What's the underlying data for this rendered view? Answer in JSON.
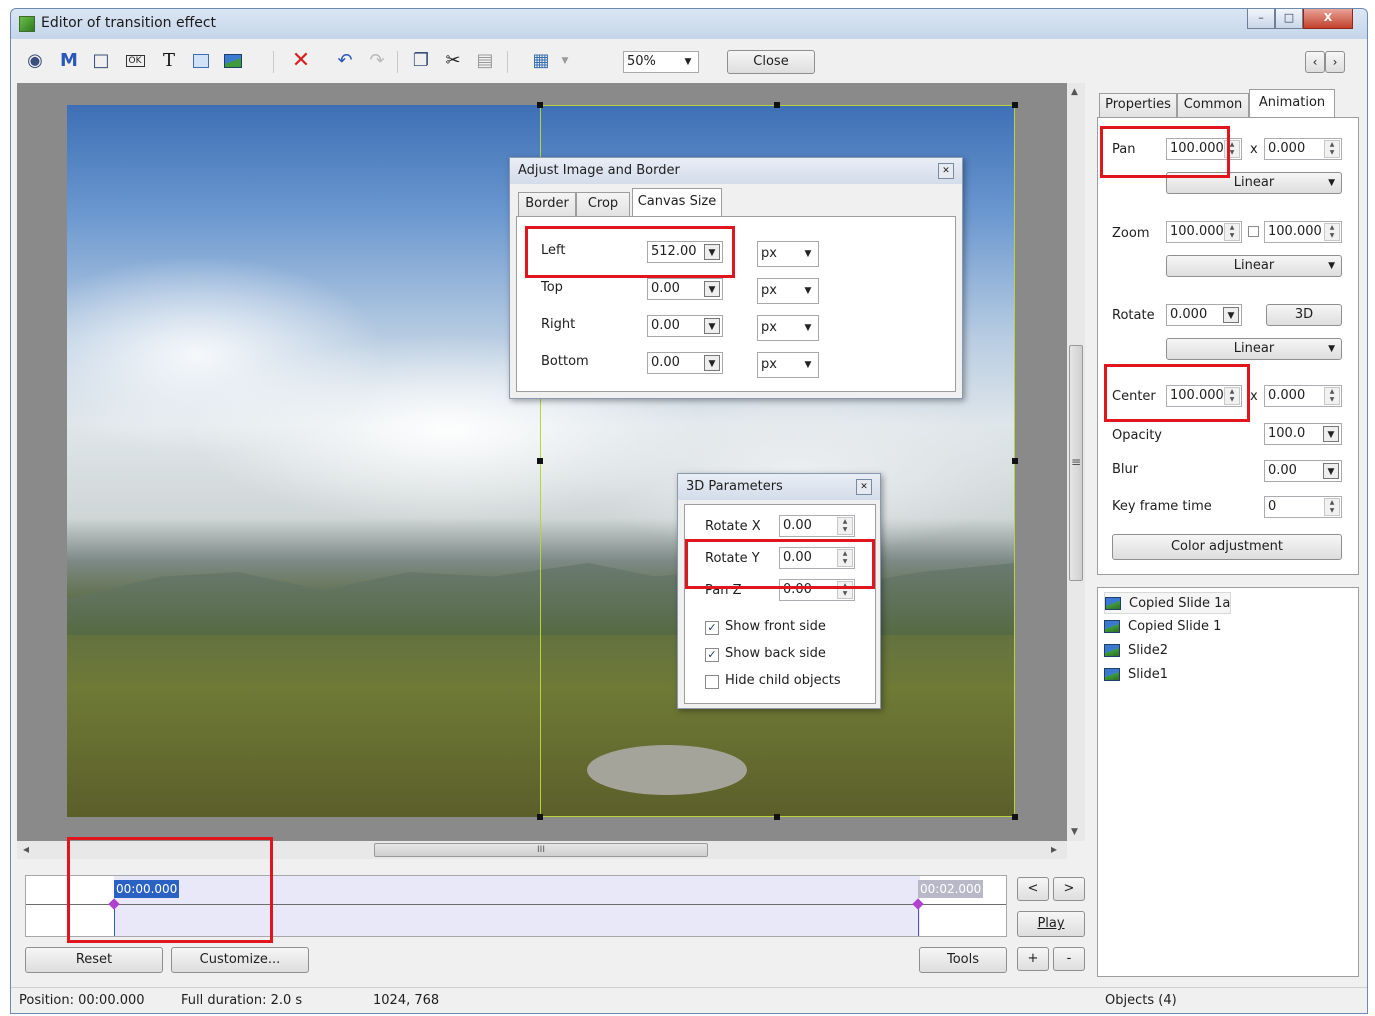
{
  "window": {
    "title": "Editor of transition effect",
    "caption_buttons": [
      "–",
      "□",
      "X"
    ]
  },
  "toolbar": {
    "icons": [
      "camera-icon",
      "text-m-icon",
      "frame-icon",
      "ok-button-icon",
      "text-t-icon",
      "rectangle-icon",
      "image-icon",
      "delete-icon",
      "undo-icon",
      "redo-icon",
      "copy-icon",
      "cut-icon",
      "paste-icon",
      "grid-icon"
    ],
    "m_glyph": "M",
    "t_glyph": "T",
    "ok_glyph": "OK",
    "zoom": "50%",
    "close_label": "Close",
    "nav_prev": "‹",
    "nav_next": "›"
  },
  "adjust_dialog": {
    "title": "Adjust Image and Border",
    "tabs": [
      "Border",
      "Crop",
      "Canvas Size"
    ],
    "active_tab": "Canvas Size",
    "rows": [
      {
        "label": "Left",
        "value": "512.00",
        "unit": "px"
      },
      {
        "label": "Top",
        "value": "0.00",
        "unit": "px"
      },
      {
        "label": "Right",
        "value": "0.00",
        "unit": "px"
      },
      {
        "label": "Bottom",
        "value": "0.00",
        "unit": "px"
      }
    ]
  },
  "params3d_dialog": {
    "title": "3D Parameters",
    "rows": [
      {
        "label": "Rotate X",
        "value": "0.00"
      },
      {
        "label": "Rotate Y",
        "value": "0.00"
      },
      {
        "label": "Pan Z",
        "value": "0.00"
      }
    ],
    "checks": [
      {
        "label": "Show front side",
        "checked": true
      },
      {
        "label": "Show back side",
        "checked": true
      },
      {
        "label": "Hide child objects",
        "checked": false
      }
    ]
  },
  "panel": {
    "tabs": [
      "Properties",
      "Common",
      "Animation"
    ],
    "active_tab": "Animation",
    "pan": {
      "label": "Pan",
      "x": "100.000",
      "sep": "x",
      "y": "0.000",
      "mode": "Linear"
    },
    "zoom": {
      "label": "Zoom",
      "x": "100.000",
      "y": "100.000",
      "mode": "Linear"
    },
    "rotate": {
      "label": "Rotate",
      "value": "0.000",
      "btn3d": "3D",
      "mode": "Linear"
    },
    "center": {
      "label": "Center",
      "x": "100.000",
      "sep": "x",
      "y": "0.000"
    },
    "opacity": {
      "label": "Opacity",
      "value": "100.0"
    },
    "blur": {
      "label": "Blur",
      "value": "0.00"
    },
    "keyframe": {
      "label": "Key frame time",
      "value": "0"
    },
    "color_adjust": "Color adjustment"
  },
  "objects": [
    "Copied Slide 1a",
    "Copied Slide 1",
    "Slide2",
    "Slide1"
  ],
  "timeline": {
    "start": "00:00.000",
    "end": "00:02.000",
    "play_label": "Play",
    "prev": "<",
    "next": ">",
    "plus": "+",
    "minus": "-"
  },
  "bottom_buttons": {
    "reset": "Reset",
    "customize": "Customize...",
    "tools": "Tools"
  },
  "scroll": {
    "h_grip": "III",
    "v_grip": "≡",
    "up": "▲",
    "down": "▼",
    "left": "◂",
    "right": "▸"
  },
  "status": {
    "position": "Position:  00:00.000",
    "duration": "Full duration:  2.0 s",
    "size": "1024, 768",
    "objects": "Objects (4)"
  },
  "colors": {
    "highlight_red": "#e0161c",
    "selection_green": "#b8d43a",
    "timeline_blue": "#2a62c4"
  }
}
